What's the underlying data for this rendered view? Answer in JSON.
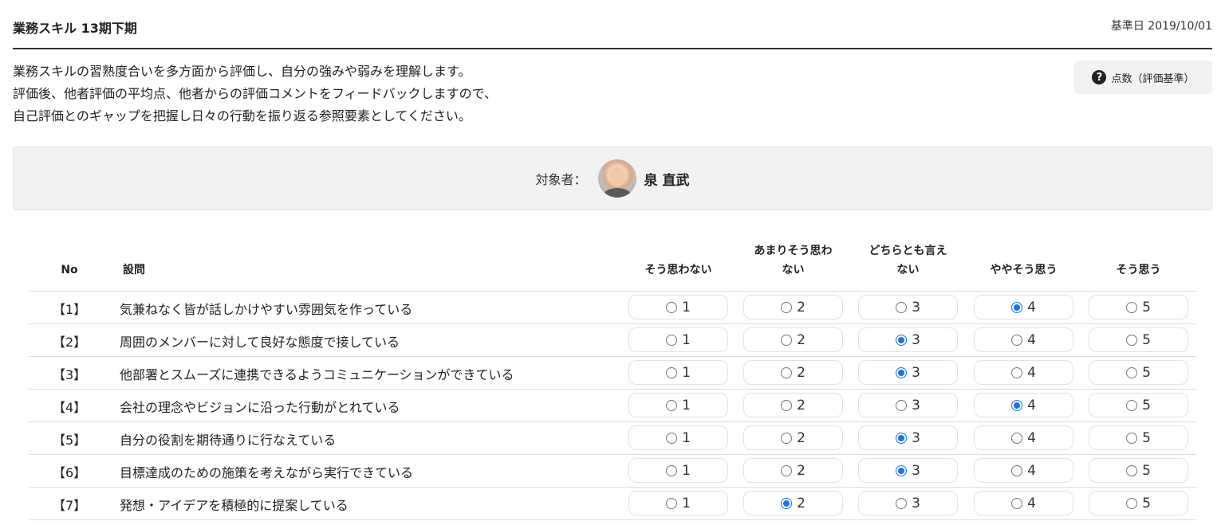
{
  "header": {
    "title": "業務スキル 13期下期",
    "base_date": "基準日 2019/10/01"
  },
  "description": {
    "lines": [
      "業務スキルの習熟度合いを多方面から評価し、自分の強みや弱みを理解します。",
      "評価後、他者評価の平均点、他者からの評価コメントをフィードバックしますので、",
      "自己評価とのギャップを把握し日々の行動を振り返る参照要素としてください。"
    ]
  },
  "criteria_button": {
    "icon": "question-circle-icon",
    "label": "点数（評価基準）"
  },
  "target": {
    "label": "対象者：",
    "name": "泉 直武"
  },
  "table": {
    "headers": {
      "no": "No",
      "question": "設問",
      "options": [
        {
          "line1": "",
          "line2": "そう思わない"
        },
        {
          "line1": "あまりそう思わ",
          "line2": "ない"
        },
        {
          "line1": "どちらとも言え",
          "line2": "ない"
        },
        {
          "line1": "",
          "line2": "ややそう思う"
        },
        {
          "line1": "",
          "line2": "そう思う"
        }
      ]
    },
    "option_values": [
      "1",
      "2",
      "3",
      "4",
      "5"
    ],
    "rows": [
      {
        "no": "【1】",
        "question": "気兼ねなく皆が話しかけやすい雰囲気を作っている",
        "selected": 4
      },
      {
        "no": "【2】",
        "question": "周囲のメンバーに対して良好な態度で接している",
        "selected": 3
      },
      {
        "no": "【3】",
        "question": "他部署とスムーズに連携できるようコミュニケーションができている",
        "selected": 3
      },
      {
        "no": "【4】",
        "question": "会社の理念やビジョンに沿った行動がとれている",
        "selected": 4
      },
      {
        "no": "【5】",
        "question": "自分の役割を期待通りに行なえている",
        "selected": 3
      },
      {
        "no": "【6】",
        "question": "目標達成のための施策を考えながら実行できている",
        "selected": 3
      },
      {
        "no": "【7】",
        "question": "発想・アイデアを積極的に提案している",
        "selected": 2
      }
    ]
  },
  "colors": {
    "accent": "#1a73e8",
    "panel_bg": "#f2f2f2",
    "divider": "#333333"
  }
}
